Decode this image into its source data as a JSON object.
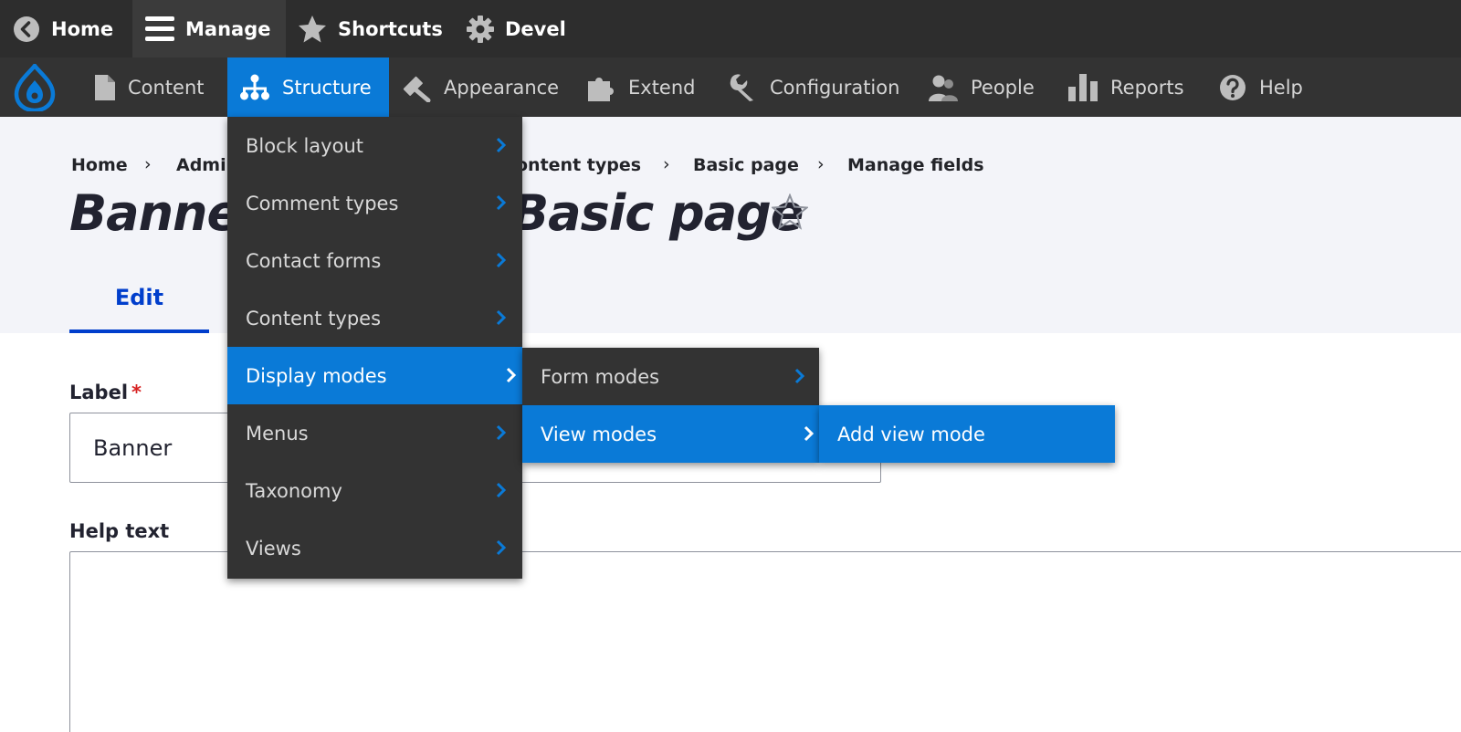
{
  "toolbar": {
    "home": "Home",
    "manage": "Manage",
    "shortcuts": "Shortcuts",
    "devel": "Devel"
  },
  "tray": {
    "items": [
      "Content",
      "Structure",
      "Appearance",
      "Extend",
      "Configuration",
      "People",
      "Reports",
      "Help"
    ]
  },
  "breadcrumb": [
    "Home",
    "Admi",
    "ontent types",
    "Basic page",
    "Manage fields"
  ],
  "page_title_left": "Banner",
  "page_title_right": "Basic page",
  "tabs": {
    "edit": "Edit"
  },
  "form": {
    "label": "Label",
    "required_mark": "*",
    "label_value": "Banner",
    "help_label": "Help text"
  },
  "structure_menu": [
    "Block layout",
    "Comment types",
    "Contact forms",
    "Content types",
    "Display modes",
    "Menus",
    "Taxonomy",
    "Views"
  ],
  "display_modes_menu": [
    "Form modes",
    "View modes"
  ],
  "view_modes_menu": [
    "Add view mode"
  ],
  "colors": {
    "accent": "#0a7ad7",
    "toolbar": "#2d2d2d",
    "tray": "#333333",
    "tab": "#003ecc"
  }
}
